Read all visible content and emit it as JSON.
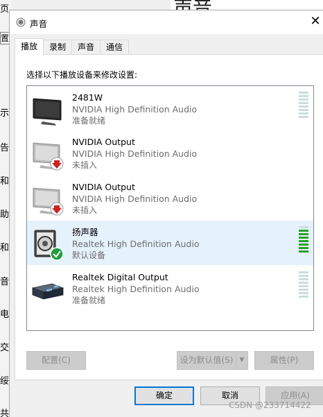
{
  "background": {
    "title": "声音",
    "left_fragments": [
      "页",
      "置",
      "示",
      "告",
      "和",
      "助",
      "和",
      "音",
      "电",
      "交",
      "绥",
      "共享"
    ]
  },
  "dialog": {
    "title": "声音",
    "close_glyph": "✕",
    "tabs": [
      {
        "label": "播放",
        "active": true
      },
      {
        "label": "录制",
        "active": false
      },
      {
        "label": "声音",
        "active": false
      },
      {
        "label": "通信",
        "active": false
      }
    ],
    "instruction": "选择以下播放设备来修改设置:",
    "devices": [
      {
        "name": "2481W",
        "driver": "NVIDIA High Definition Audio",
        "status": "准备就绪",
        "icon": "monitor-icon",
        "badge": "",
        "selected": false,
        "meter_level": 0
      },
      {
        "name": "NVIDIA Output",
        "driver": "NVIDIA High Definition Audio",
        "status": "未插入",
        "icon": "monitor-icon",
        "badge": "unplugged-arrow-badge",
        "selected": false,
        "meter_level": null
      },
      {
        "name": "NVIDIA Output",
        "driver": "NVIDIA High Definition Audio",
        "status": "未插入",
        "icon": "monitor-icon",
        "badge": "unplugged-arrow-badge",
        "selected": false,
        "meter_level": null
      },
      {
        "name": "扬声器",
        "driver": "Realtek High Definition Audio",
        "status": "默认设备",
        "icon": "speaker-icon",
        "badge": "default-check-badge",
        "selected": true,
        "meter_level": 0.9
      },
      {
        "name": "Realtek Digital Output",
        "driver": "Realtek High Definition Audio",
        "status": "准备就绪",
        "icon": "digital-output-icon",
        "badge": "",
        "selected": false,
        "meter_level": 0
      }
    ],
    "buttons": {
      "configure": "配置(C)",
      "set_default": "设为默认值(S)",
      "set_default_arrow": "▼",
      "properties": "属性(P)",
      "ok": "确定",
      "cancel": "取消",
      "apply": "应用(A)"
    }
  },
  "watermark": "CSDN @233714422",
  "colors": {
    "accent": "#0078d7",
    "selected_row": "#e5f1fb",
    "meter_on": "#27a12a",
    "meter_off": "#c8dede",
    "unplugged_badge": "#d21f1f",
    "default_badge": "#1e9e3a"
  }
}
